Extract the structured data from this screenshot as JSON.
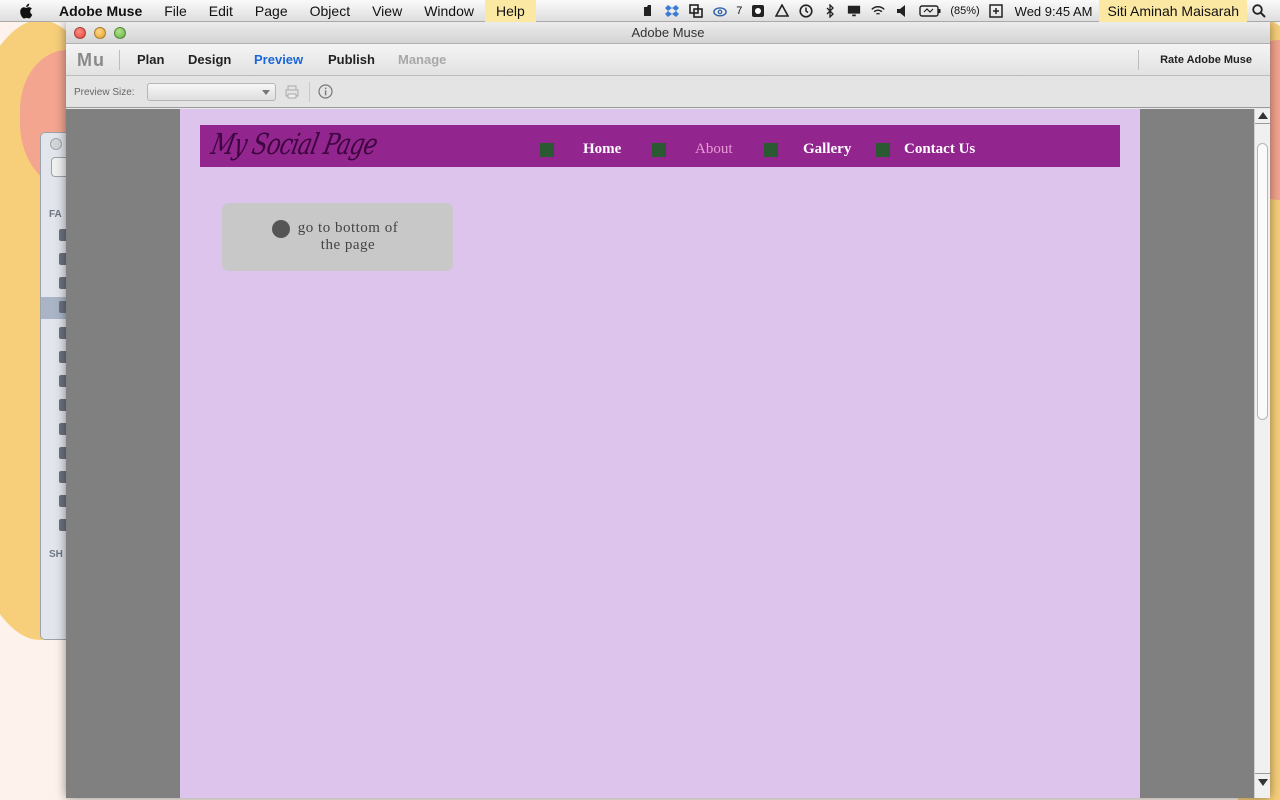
{
  "menubar": {
    "app_name": "Adobe Muse",
    "menus": [
      "File",
      "Edit",
      "Page",
      "Object",
      "View",
      "Window",
      "Help"
    ],
    "status": {
      "cc_count": "7",
      "battery": "(85%)",
      "clock": "Wed 9:45 AM",
      "user": "Siti Aminah Maisarah"
    }
  },
  "window": {
    "title": "Adobe Muse"
  },
  "toolbar": {
    "logo": "Mu",
    "modes": [
      "Plan",
      "Design",
      "Preview",
      "Publish",
      "Manage"
    ],
    "active_mode": "Preview",
    "rate_label": "Rate Adobe Muse"
  },
  "preview_bar": {
    "size_label": "Preview Size:",
    "size_value": ""
  },
  "site": {
    "logo_text": "My Social Page",
    "nav": [
      "Home",
      "About",
      "Gallery",
      "Contact Us"
    ],
    "current_page": "About",
    "anchor_text_line1": "go to bottom of",
    "anchor_text_line2": "the page"
  },
  "colors": {
    "page_background": "#dcc4ec",
    "header_background": "#93268e",
    "nav_bullet": "#2a5a32",
    "nav_current": "#e89bd4",
    "preview_tab_active": "#1c67d8",
    "stage_background": "#808080"
  }
}
